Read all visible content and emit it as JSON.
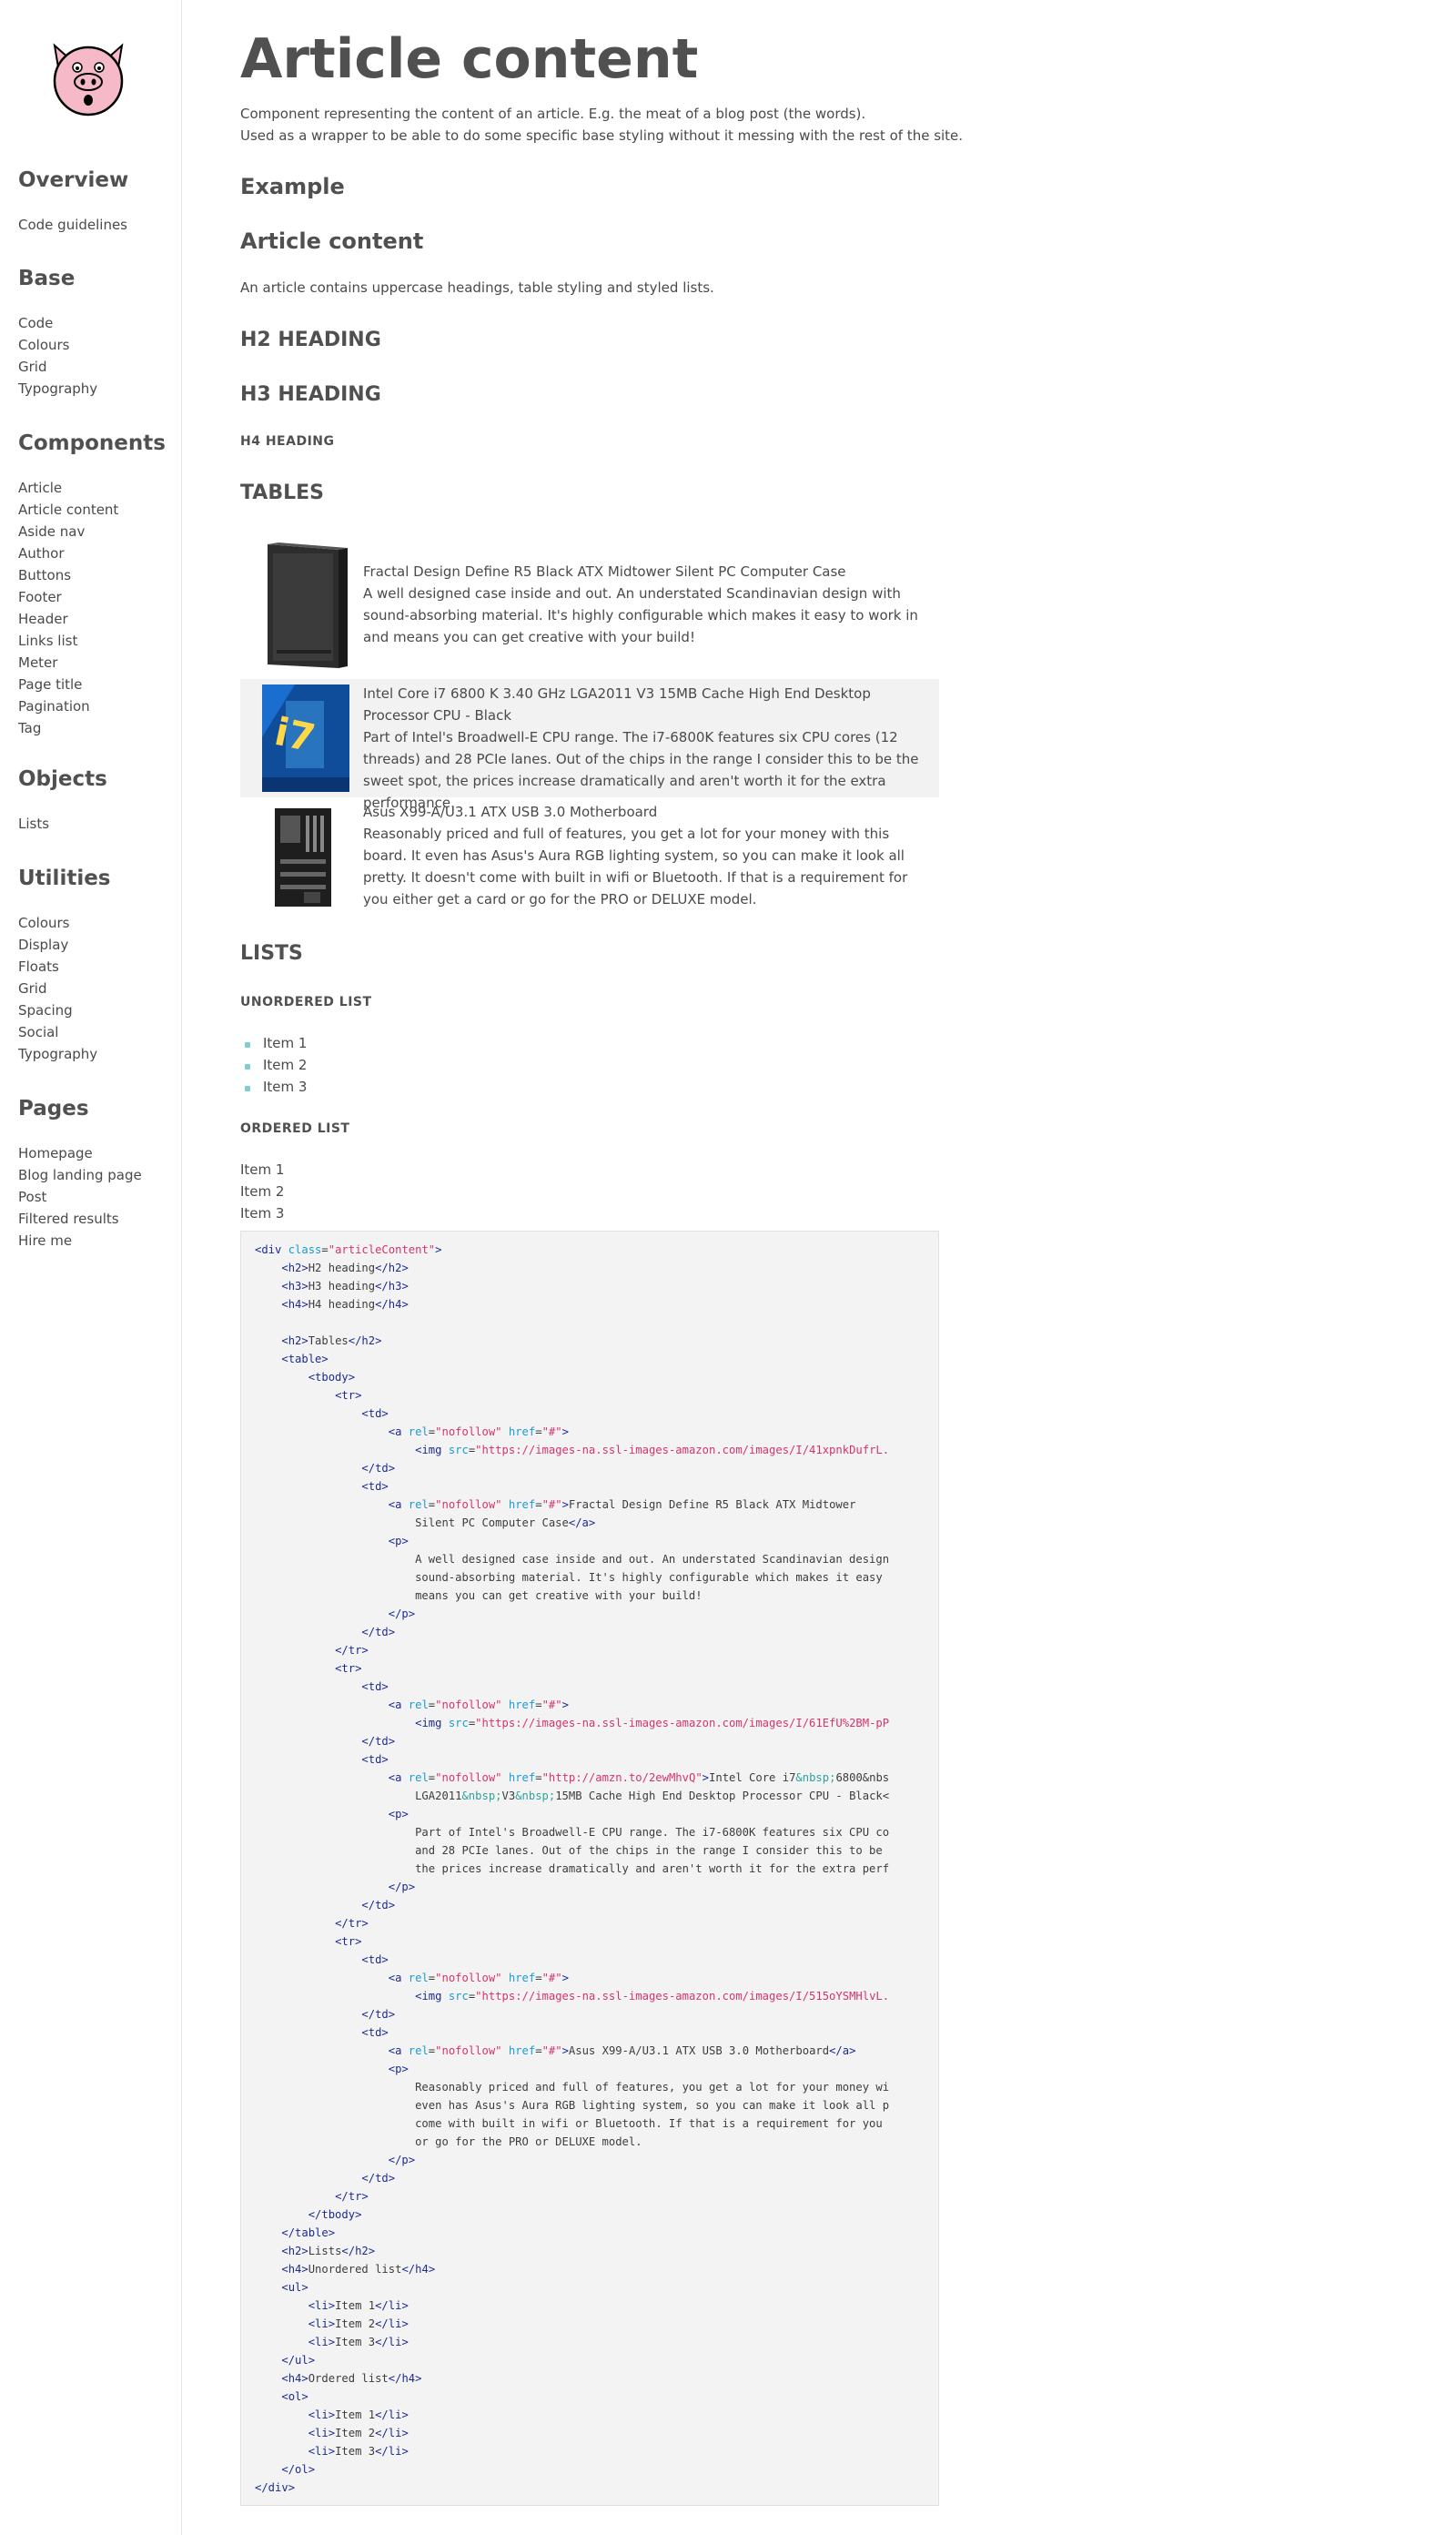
{
  "sidebar": {
    "groups": [
      {
        "heading": "Overview",
        "items": [
          "Code guidelines"
        ]
      },
      {
        "heading": "Base",
        "items": [
          "Code",
          "Colours",
          "Grid",
          "Typography"
        ]
      },
      {
        "heading": "Components",
        "items": [
          "Article",
          "Article content",
          "Aside nav",
          "Author",
          "Buttons",
          "Footer",
          "Header",
          "Links list",
          "Meter",
          "Page title",
          "Pagination",
          "Tag"
        ]
      },
      {
        "heading": "Objects",
        "items": [
          "Lists"
        ]
      },
      {
        "heading": "Utilities",
        "items": [
          "Colours",
          "Display",
          "Floats",
          "Grid",
          "Spacing",
          "Social",
          "Typography"
        ]
      },
      {
        "heading": "Pages",
        "items": [
          "Homepage",
          "Blog landing page",
          "Post",
          "Filtered results",
          "Hire me"
        ]
      }
    ]
  },
  "main": {
    "title": "Article content",
    "lead_line1": "Component representing the content of an article. E.g. the meat of a blog post (the words).",
    "lead_line2": "Used as a wrapper to be able to do some specific base styling without it messing with the rest of the site.",
    "example_heading": "Example",
    "article_heading": "Article content",
    "intro": "An article contains uppercase headings, table styling and styled lists.",
    "h2": "H2 Heading",
    "h3": "H3 Heading",
    "h4": "H4 Heading",
    "tables_heading": "Tables",
    "products": [
      {
        "title": "Fractal Design Define R5 Black ATX Midtower Silent PC Computer Case",
        "desc": "A well designed case inside and out. An understated Scandinavian design with sound-absorbing material. It's highly configurable which makes it easy to work in and means you can get creative with your build!"
      },
      {
        "title": "Intel Core i7 6800 K 3.40 GHz LGA2011 V3 15MB Cache High End Desktop Processor CPU - Black",
        "desc": "Part of Intel's Broadwell-E CPU range. The i7-6800K features six CPU cores (12 threads) and 28 PCIe lanes. Out of the chips in the range I consider this to be the sweet spot, the prices increase dramatically and aren't worth it for the extra performance."
      },
      {
        "title": "Asus X99-A/U3.1 ATX USB 3.0 Motherboard",
        "desc": "Reasonably priced and full of features, you get a lot for your money with this board. It even has Asus's Aura RGB lighting system, so you can make it look all pretty. It doesn't come with built in wifi or Bluetooth. If that is a requirement for you either get a card or go for the PRO or DELUXE model."
      }
    ],
    "lists_heading": "Lists",
    "unordered_heading": "Unordered list",
    "unordered_items": [
      "Item 1",
      "Item 2",
      "Item 3"
    ],
    "ordered_heading": "Ordered list",
    "ordered_items": [
      "Item 1",
      "Item 2",
      "Item 3"
    ]
  },
  "code": {
    "lines": [
      "<div class=\"articleContent\">",
      "    <h2>H2 heading</h2>",
      "    <h3>H3 heading</h3>",
      "    <h4>H4 heading</h4>",
      "",
      "    <h2>Tables</h2>",
      "    <table>",
      "        <tbody>",
      "            <tr>",
      "                <td>",
      "                    <a rel=\"nofollow\" href=\"#\">",
      "                        <img src=\"https://images-na.ssl-images-amazon.com/images/I/41xpnkDufrL.",
      "                </td>",
      "                <td>",
      "                    <a rel=\"nofollow\" href=\"#\">Fractal Design Define R5 Black ATX Midtower",
      "                        Silent PC Computer Case</a>",
      "                    <p>",
      "                        A well designed case inside and out. An understated Scandinavian design",
      "                        sound-absorbing material. It's highly configurable which makes it easy",
      "                        means you can get creative with your build!",
      "                    </p>",
      "                </td>",
      "            </tr>",
      "            <tr>",
      "                <td>",
      "                    <a rel=\"nofollow\" href=\"#\">",
      "                        <img src=\"https://images-na.ssl-images-amazon.com/images/I/61EfU%2BM-pP",
      "                </td>",
      "                <td>",
      "                    <a rel=\"nofollow\" href=\"http://amzn.to/2ewMhvQ\">Intel Core i7&nbsp;6800&nbs",
      "                        LGA2011&nbsp;V3&nbsp;15MB Cache High End Desktop Processor CPU - Black<",
      "                    <p>",
      "                        Part of Intel's Broadwell-E CPU range. The i7-6800K features six CPU co",
      "                        and 28 PCIe lanes. Out of the chips in the range I consider this to be",
      "                        the prices increase dramatically and aren't worth it for the extra perf",
      "                    </p>",
      "                </td>",
      "            </tr>",
      "            <tr>",
      "                <td>",
      "                    <a rel=\"nofollow\" href=\"#\">",
      "                        <img src=\"https://images-na.ssl-images-amazon.com/images/I/515oYSMHlvL.",
      "                </td>",
      "                <td>",
      "                    <a rel=\"nofollow\" href=\"#\">Asus X99-A/U3.1 ATX USB 3.0 Motherboard</a>",
      "                    <p>",
      "                        Reasonably priced and full of features, you get a lot for your money wi",
      "                        even has Asus's Aura RGB lighting system, so you can make it look all p",
      "                        come with built in wifi or Bluetooth. If that is a requirement for you",
      "                        or go for the PRO or DELUXE model.",
      "                    </p>",
      "                </td>",
      "            </tr>",
      "        </tbody>",
      "    </table>",
      "    <h2>Lists</h2>",
      "    <h4>Unordered list</h4>",
      "    <ul>",
      "        <li>Item 1</li>",
      "        <li>Item 2</li>",
      "        <li>Item 3</li>",
      "    </ul>",
      "    <h4>Ordered list</h4>",
      "    <ol>",
      "        <li>Item 1</li>",
      "        <li>Item 2</li>",
      "        <li>Item 3</li>",
      "    </ol>",
      "</div>"
    ]
  },
  "icons": {
    "logo": "pig-face-icon"
  },
  "colors": {
    "accent": "#7ccfd3",
    "code_bg": "#f3f3f3",
    "text": "#4a4a4a",
    "pig": "#f5b9c8"
  }
}
